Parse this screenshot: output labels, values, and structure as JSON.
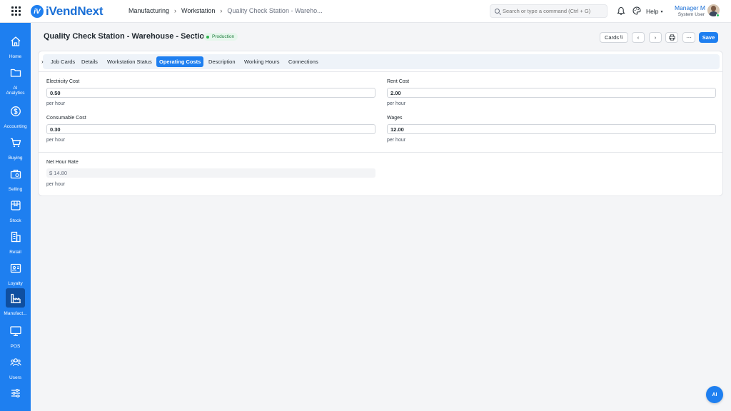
{
  "app": {
    "name": "iVendNext",
    "logo_mark": "iV"
  },
  "breadcrumb": [
    "Manufacturing",
    "Workstation",
    "Quality Check Station - Wareho..."
  ],
  "search": {
    "placeholder": "Search or type a command (Ctrl + G)"
  },
  "header": {
    "help_label": "Help",
    "user_name": "Manager M",
    "user_role": "System User"
  },
  "sidebar": {
    "items": [
      {
        "label": "Home",
        "icon": "home-icon"
      },
      {
        "label": "AI Analytics",
        "icon": "folder-icon"
      },
      {
        "label": "Accounting",
        "icon": "dollar-icon"
      },
      {
        "label": "Buying",
        "icon": "cart-icon"
      },
      {
        "label": "Selling",
        "icon": "briefcase-icon"
      },
      {
        "label": "Stock",
        "icon": "box-icon"
      },
      {
        "label": "Retail",
        "icon": "store-icon"
      },
      {
        "label": "Loyalty",
        "icon": "id-card-icon"
      },
      {
        "label": "Manufact...",
        "icon": "factory-icon",
        "active": true
      },
      {
        "label": "POS",
        "icon": "monitor-icon"
      },
      {
        "label": "Users",
        "icon": "users-icon"
      },
      {
        "label": "",
        "icon": "settings-sliders-icon"
      }
    ]
  },
  "page": {
    "title": "Quality Check Station - Warehouse - Section A",
    "status": "Production",
    "view_select": "Cards",
    "save_label": "Save"
  },
  "tabs": [
    {
      "label": "Job Cards"
    },
    {
      "label": "Details"
    },
    {
      "label": "Workstation Status"
    },
    {
      "label": "Operating Costs",
      "active": true
    },
    {
      "label": "Description"
    },
    {
      "label": "Working Hours"
    },
    {
      "label": "Connections"
    }
  ],
  "fields": {
    "electricity_cost": {
      "label": "Electricity Cost",
      "value": "0.50",
      "help": "per hour"
    },
    "rent_cost": {
      "label": "Rent Cost",
      "value": "2.00",
      "help": "per hour"
    },
    "consumable_cost": {
      "label": "Consumable Cost",
      "value": "0.30",
      "help": "per hour"
    },
    "wages": {
      "label": "Wages",
      "value": "12.00",
      "help": "per hour"
    },
    "net_hour_rate": {
      "label": "Net Hour Rate",
      "value": "$ 14.80",
      "help": "per hour"
    }
  },
  "ai_button": {
    "label": "AI"
  },
  "colors": {
    "accent": "#1e7ff0",
    "sidebar": "#1e7ff0",
    "status_green": "#2fb34f"
  }
}
